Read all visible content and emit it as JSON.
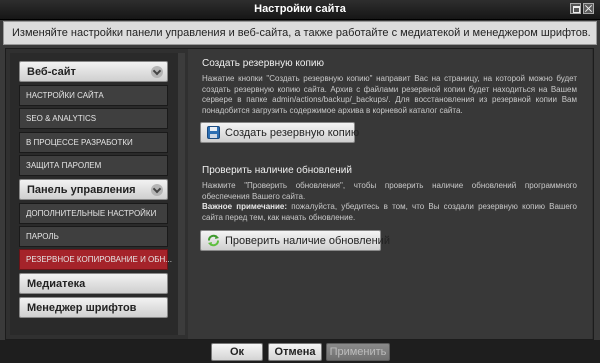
{
  "window": {
    "title": "Настройки сайта"
  },
  "info": {
    "text": "Изменяйте настройки панели управления и веб-сайта, а также работайте с медиатекой и менеджером шрифтов."
  },
  "sidebar": {
    "groups": [
      {
        "label": "Веб-сайт",
        "items": [
          "НАСТРОЙКИ САЙТА",
          "SEO & ANALYTICS",
          "В ПРОЦЕССЕ РАЗРАБОТКИ",
          "ЗАЩИТА ПАРОЛЕМ"
        ]
      },
      {
        "label": "Панель управления",
        "items": [
          "ДОПОЛНИТЕЛЬНЫЕ НАСТРОЙКИ",
          "ПАРОЛЬ",
          "РЕЗЕРВНОЕ КОПИРОВАНИЕ И ОБН..."
        ]
      },
      {
        "label": "Медиатека",
        "items": []
      },
      {
        "label": "Менеджер шрифтов",
        "items": []
      }
    ],
    "active_item": "РЕЗЕРВНОЕ КОПИРОВАНИЕ И ОБН..."
  },
  "backup": {
    "title": "Создать резервную копию",
    "text": "Нажатие кнопки \"Создать резервную копию\" направит Вас на страницу, на которой можно будет создать резервную копию сайта. Архив с файлами резервной копии будет находиться на Вашем сервере в папке admin/actions/backup/_backups/. Для восстановления из резервной копии Вам понадобится загрузить содержимое архива в корневой каталог сайта.",
    "button_label": "Создать резервную копию"
  },
  "updates": {
    "title": "Проверить наличие обновлений",
    "text": "Нажмите \"Проверить обновления\", чтобы проверить наличие обновлений программного обеспечения Вашего сайта.",
    "note_label": "Важное примечание:",
    "note_text": " пожалуйста, убедитесь в том, что Вы создали резервную копию Вашего сайта перед тем, как начать обновление.",
    "button_label": "Проверить наличие обновлений"
  },
  "footer": {
    "ok_label": "Ок",
    "cancel_label": "Отмена",
    "apply_label": "Применить"
  },
  "colors": {
    "active_item": "#a5232a",
    "window_bg": "#3a3a3a",
    "info_bg": "#dcdcdc"
  },
  "icons": {
    "backup_button": "floppy-disk-icon",
    "update_button": "refresh-arrows-icon"
  }
}
